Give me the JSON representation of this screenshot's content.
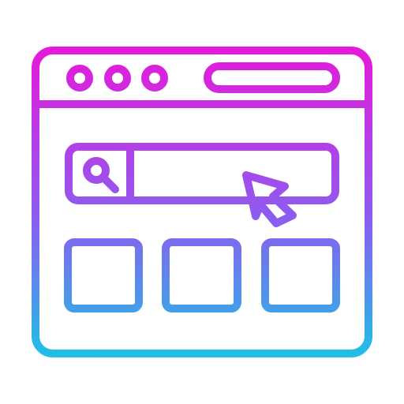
{
  "icon": {
    "name": "browser-search-window-icon",
    "gradient": {
      "top": "#e619d9",
      "middle": "#8d5cf0",
      "bottom": "#1ec0e6"
    },
    "background": "#ffffff",
    "window_controls": [
      "dot-1",
      "dot-2",
      "dot-3"
    ],
    "content_tiles": [
      "tile-1",
      "tile-2",
      "tile-3"
    ],
    "elements": {
      "search_icon": "magnifier-icon",
      "pointer_icon": "cursor-arrow-icon"
    }
  }
}
